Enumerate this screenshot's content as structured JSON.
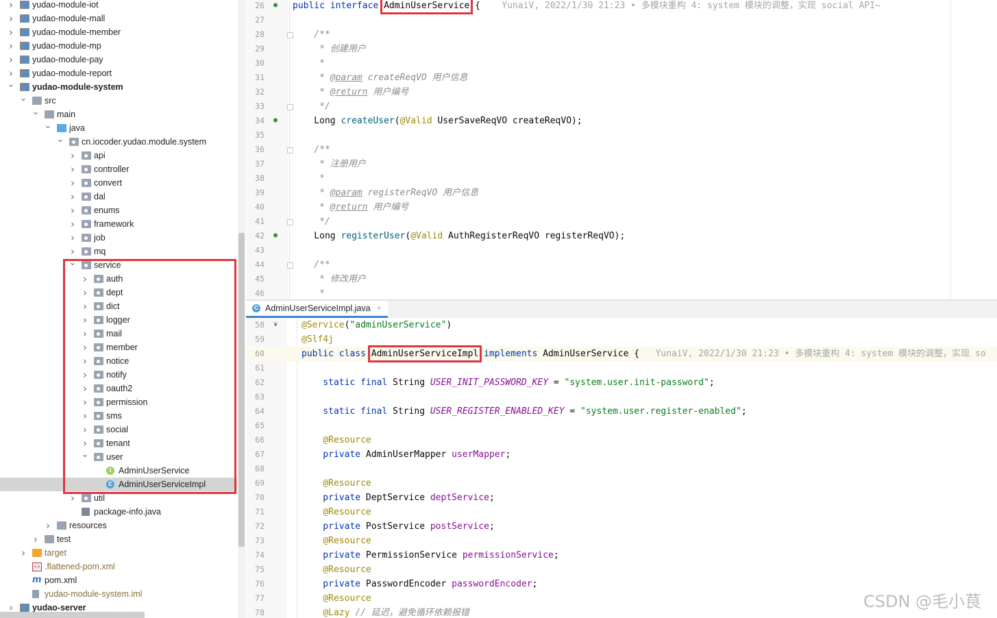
{
  "project_tree": {
    "rows": [
      {
        "label": "yudao-module-iot",
        "icon": "module-icon",
        "expanded": false,
        "bold": false
      },
      {
        "label": "yudao-module-mall",
        "icon": "module-icon",
        "expanded": false,
        "bold": false
      },
      {
        "label": "yudao-module-member",
        "icon": "module-icon",
        "expanded": false,
        "bold": false
      },
      {
        "label": "yudao-module-mp",
        "icon": "module-icon",
        "expanded": false,
        "bold": false
      },
      {
        "label": "yudao-module-pay",
        "icon": "module-icon",
        "expanded": false,
        "bold": false
      },
      {
        "label": "yudao-module-report",
        "icon": "module-icon",
        "expanded": false,
        "bold": false
      },
      {
        "label": "yudao-module-system",
        "icon": "module-icon",
        "expanded": true,
        "bold": true
      },
      {
        "label": "src",
        "icon": "folder-icon",
        "expanded": true
      },
      {
        "label": "main",
        "icon": "folder-icon",
        "expanded": true
      },
      {
        "label": "java",
        "icon": "source-folder-icon",
        "expanded": true
      },
      {
        "label": "cn.iocoder.yudao.module.system",
        "icon": "package-icon",
        "expanded": true
      },
      {
        "label": "api",
        "icon": "package-icon",
        "expanded": false
      },
      {
        "label": "controller",
        "icon": "package-icon",
        "expanded": false
      },
      {
        "label": "convert",
        "icon": "package-icon",
        "expanded": false
      },
      {
        "label": "dal",
        "icon": "package-icon",
        "expanded": false
      },
      {
        "label": "enums",
        "icon": "package-icon",
        "expanded": false
      },
      {
        "label": "framework",
        "icon": "package-icon",
        "expanded": false
      },
      {
        "label": "job",
        "icon": "package-icon",
        "expanded": false
      },
      {
        "label": "mq",
        "icon": "package-icon",
        "expanded": false
      },
      {
        "label": "service",
        "icon": "package-icon",
        "expanded": true
      },
      {
        "label": "auth",
        "icon": "package-icon",
        "expanded": false
      },
      {
        "label": "dept",
        "icon": "package-icon",
        "expanded": false
      },
      {
        "label": "dict",
        "icon": "package-icon",
        "expanded": false
      },
      {
        "label": "logger",
        "icon": "package-icon",
        "expanded": false
      },
      {
        "label": "mail",
        "icon": "package-icon",
        "expanded": false
      },
      {
        "label": "member",
        "icon": "package-icon",
        "expanded": false
      },
      {
        "label": "notice",
        "icon": "package-icon",
        "expanded": false
      },
      {
        "label": "notify",
        "icon": "package-icon",
        "expanded": false
      },
      {
        "label": "oauth2",
        "icon": "package-icon",
        "expanded": false
      },
      {
        "label": "permission",
        "icon": "package-icon",
        "expanded": false
      },
      {
        "label": "sms",
        "icon": "package-icon",
        "expanded": false
      },
      {
        "label": "social",
        "icon": "package-icon",
        "expanded": false
      },
      {
        "label": "tenant",
        "icon": "package-icon",
        "expanded": false
      },
      {
        "label": "user",
        "icon": "package-icon",
        "expanded": true
      },
      {
        "label": "AdminUserService",
        "icon": "interface-icon"
      },
      {
        "label": "AdminUserServiceImpl",
        "icon": "class-icon",
        "selected": true
      },
      {
        "label": "util",
        "icon": "package-icon",
        "expanded": false
      },
      {
        "label": "package-info.java",
        "icon": "java-file-icon"
      },
      {
        "label": "resources",
        "icon": "resources-folder-icon",
        "expanded": false
      },
      {
        "label": "test",
        "icon": "folder-icon",
        "expanded": false
      },
      {
        "label": "target",
        "icon": "excluded-folder-icon",
        "expanded": false,
        "excluded": true
      },
      {
        "label": ".flattened-pom.xml",
        "icon": "xml-file-icon",
        "excluded": true
      },
      {
        "label": "pom.xml",
        "icon": "maven-icon"
      },
      {
        "label": "yudao-module-system.iml",
        "icon": "iml-file-icon",
        "excluded": true
      },
      {
        "label": "yudao-server",
        "icon": "module-icon",
        "expanded": false,
        "bold": true
      }
    ]
  },
  "editor_top": {
    "lines": [
      {
        "n": "26",
        "gutter": "implemented-icon",
        "tokens": [
          [
            "kw",
            "public interface "
          ],
          [
            "hl",
            "AdminUserService"
          ],
          [
            "",
            " {"
          ],
          [
            "blame",
            "    YunaiV, 2022/1/30 21:23 • 多模块重构 4: system 模块的调整，实现 social API~"
          ]
        ]
      },
      {
        "n": "27",
        "tokens": []
      },
      {
        "n": "28",
        "fold": true,
        "tokens": [
          [
            "doc",
            "    /**"
          ]
        ]
      },
      {
        "n": "29",
        "tokens": [
          [
            "doc",
            "     * 创建用户"
          ]
        ]
      },
      {
        "n": "30",
        "tokens": [
          [
            "doc",
            "     *"
          ]
        ]
      },
      {
        "n": "31",
        "tokens": [
          [
            "doc",
            "     * "
          ],
          [
            "doctag",
            "@param"
          ],
          [
            "doc",
            " createReqVO "
          ],
          [
            "cmt",
            "用户信息"
          ]
        ]
      },
      {
        "n": "32",
        "tokens": [
          [
            "doc",
            "     * "
          ],
          [
            "doctag",
            "@return"
          ],
          [
            "cmt",
            " 用户编号"
          ]
        ]
      },
      {
        "n": "33",
        "fold": true,
        "tokens": [
          [
            "doc",
            "     */"
          ]
        ]
      },
      {
        "n": "34",
        "gutter": "implemented-icon",
        "tokens": [
          [
            "",
            "    Long "
          ],
          [
            "fn",
            "createUser"
          ],
          [
            "",
            "("
          ],
          [
            "ann",
            "@Valid"
          ],
          [
            "",
            " UserSaveReqVO createReqVO);"
          ]
        ]
      },
      {
        "n": "35",
        "tokens": []
      },
      {
        "n": "36",
        "fold": true,
        "tokens": [
          [
            "doc",
            "    /**"
          ]
        ]
      },
      {
        "n": "37",
        "tokens": [
          [
            "doc",
            "     * 注册用户"
          ]
        ]
      },
      {
        "n": "38",
        "tokens": [
          [
            "doc",
            "     *"
          ]
        ]
      },
      {
        "n": "39",
        "tokens": [
          [
            "doc",
            "     * "
          ],
          [
            "doctag",
            "@param"
          ],
          [
            "doc",
            " registerReqVO "
          ],
          [
            "cmt",
            "用户信息"
          ]
        ]
      },
      {
        "n": "40",
        "tokens": [
          [
            "doc",
            "     * "
          ],
          [
            "doctag",
            "@return"
          ],
          [
            "cmt",
            " 用户编号"
          ]
        ]
      },
      {
        "n": "41",
        "fold": true,
        "tokens": [
          [
            "doc",
            "     */"
          ]
        ]
      },
      {
        "n": "42",
        "gutter": "implemented-icon",
        "tokens": [
          [
            "",
            "    Long "
          ],
          [
            "fn",
            "registerUser"
          ],
          [
            "",
            "("
          ],
          [
            "ann",
            "@Valid"
          ],
          [
            "",
            " AuthRegisterReqVO registerReqVO);"
          ]
        ]
      },
      {
        "n": "43",
        "tokens": []
      },
      {
        "n": "44",
        "fold": true,
        "tokens": [
          [
            "doc",
            "    /**"
          ]
        ]
      },
      {
        "n": "45",
        "tokens": [
          [
            "doc",
            "     * 修改用户"
          ]
        ]
      },
      {
        "n": "46",
        "tokens": [
          [
            "doc",
            "     *"
          ]
        ]
      }
    ]
  },
  "tab": {
    "label": "AdminUserServiceImpl.java",
    "icon": "class-icon",
    "close": "×"
  },
  "editor_bottom": {
    "lines": [
      {
        "n": "58",
        "gutter": "spring-bean-icon",
        "tokens": [
          [
            "ann",
            "@Service"
          ],
          [
            "",
            "("
          ],
          [
            "str",
            "\"adminUserService\""
          ],
          [
            "",
            ")"
          ]
        ]
      },
      {
        "n": "59",
        "tokens": [
          [
            "ann",
            "@Slf4j"
          ]
        ]
      },
      {
        "n": "60",
        "current": true,
        "tokens": [
          [
            "kw",
            "public class "
          ],
          [
            "hl",
            "AdminUserServiceImpl"
          ],
          [
            "kw",
            " implements "
          ],
          [
            "",
            "AdminUserService {"
          ],
          [
            "blame",
            "   YunaiV, 2022/1/30 21:23 • 多模块重构 4: system 模块的调整，实现 so"
          ]
        ]
      },
      {
        "n": "61",
        "tokens": []
      },
      {
        "n": "62",
        "tokens": [
          [
            "kw",
            "    static final "
          ],
          [
            "",
            "String "
          ],
          [
            "cst",
            "USER_INIT_PASSWORD_KEY"
          ],
          [
            "",
            " = "
          ],
          [
            "str",
            "\"system.user.init-password\""
          ],
          [
            "",
            ";"
          ]
        ]
      },
      {
        "n": "63",
        "tokens": []
      },
      {
        "n": "64",
        "tokens": [
          [
            "kw",
            "    static final "
          ],
          [
            "",
            "String "
          ],
          [
            "cst",
            "USER_REGISTER_ENABLED_KEY"
          ],
          [
            "",
            " = "
          ],
          [
            "str",
            "\"system.user.register-enabled\""
          ],
          [
            "",
            ";"
          ]
        ]
      },
      {
        "n": "65",
        "tokens": []
      },
      {
        "n": "66",
        "tokens": [
          [
            "ann",
            "    @Resource"
          ]
        ]
      },
      {
        "n": "67",
        "tokens": [
          [
            "kw",
            "    private "
          ],
          [
            "",
            "AdminUserMapper "
          ],
          [
            "fld",
            "userMapper"
          ],
          [
            "",
            ";"
          ]
        ]
      },
      {
        "n": "68",
        "tokens": []
      },
      {
        "n": "69",
        "tokens": [
          [
            "ann",
            "    @Resource"
          ]
        ]
      },
      {
        "n": "70",
        "tokens": [
          [
            "kw",
            "    private "
          ],
          [
            "",
            "DeptService "
          ],
          [
            "fld",
            "deptService"
          ],
          [
            "",
            ";"
          ]
        ]
      },
      {
        "n": "71",
        "tokens": [
          [
            "ann",
            "    @Resource"
          ]
        ]
      },
      {
        "n": "72",
        "tokens": [
          [
            "kw",
            "    private "
          ],
          [
            "",
            "PostService "
          ],
          [
            "fld",
            "postService"
          ],
          [
            "",
            ";"
          ]
        ]
      },
      {
        "n": "73",
        "tokens": [
          [
            "ann",
            "    @Resource"
          ]
        ]
      },
      {
        "n": "74",
        "tokens": [
          [
            "kw",
            "    private "
          ],
          [
            "",
            "PermissionService "
          ],
          [
            "fld",
            "permissionService"
          ],
          [
            "",
            ";"
          ]
        ]
      },
      {
        "n": "75",
        "tokens": [
          [
            "ann",
            "    @Resource"
          ]
        ]
      },
      {
        "n": "76",
        "tokens": [
          [
            "kw",
            "    private "
          ],
          [
            "",
            "PasswordEncoder "
          ],
          [
            "fld",
            "passwordEncoder"
          ],
          [
            "",
            ";"
          ]
        ]
      },
      {
        "n": "77",
        "tokens": [
          [
            "ann",
            "    @Resource"
          ]
        ]
      },
      {
        "n": "78",
        "tokens": [
          [
            "ann",
            "    @Lazy"
          ],
          [
            "cmt",
            " // 延迟，避免循环依赖报错"
          ]
        ]
      }
    ]
  },
  "watermark": "CSDN @毛小茛",
  "colors": {
    "highlight_box": "#e0343f",
    "selection": "#d4d4d4",
    "keyword": "#0033b3",
    "string": "#067d17",
    "annotation": "#9e880d"
  }
}
